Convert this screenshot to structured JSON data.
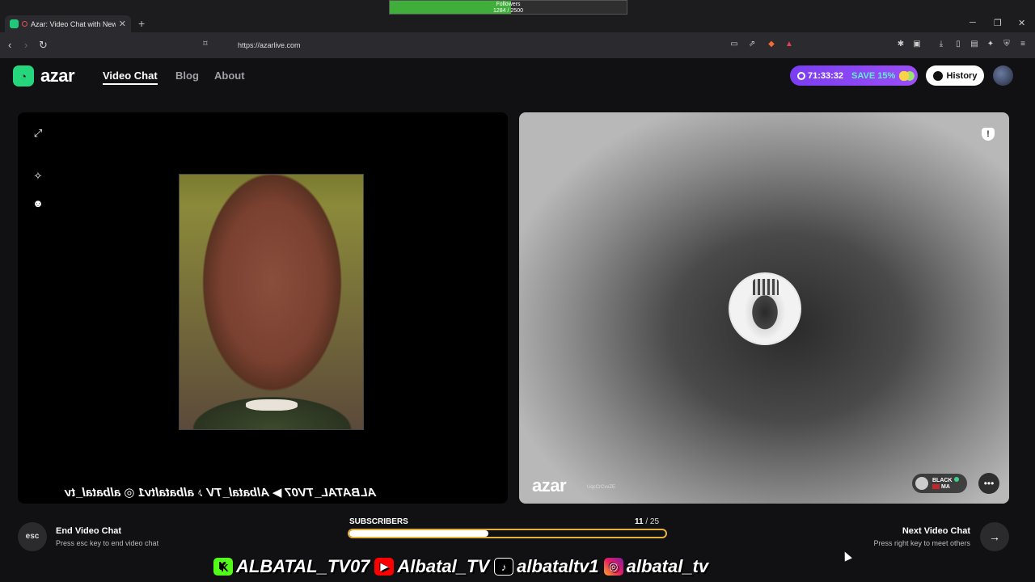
{
  "browser": {
    "tab_title": "Azar: Video Chat with New Pe",
    "url": "https://azarlive.com"
  },
  "followers_overlay": {
    "label": "Followers",
    "current": 1284,
    "goal": 2500,
    "count_text": "1284 / 2500"
  },
  "header": {
    "logo": "azar",
    "nav": [
      "Video Chat",
      "Blog",
      "About"
    ],
    "active_nav": "Video Chat",
    "promo_timer": "71:33:32",
    "promo_save": "SAVE 15%",
    "history_label": "History"
  },
  "left_panel": {
    "mirrored_socials": "ALBATAL_TV07 ▶ Albatal_TV ♪ albataltv1 ◎ albatal_tv"
  },
  "right_panel": {
    "watermark": "azar",
    "watermark_id": "UqcCrCvvZE",
    "partner_name": "BLACK",
    "partner_country": "MA"
  },
  "bottom": {
    "end_key": "esc",
    "end_title": "End Video Chat",
    "end_hint": "Press esc key to end video chat",
    "next_title": "Next Video Chat",
    "next_hint": "Press right key to meet others",
    "subs_label": "SUBSCRIBERS",
    "subs_current": "11",
    "subs_total": "/ 25",
    "subs_fraction": 0.44
  },
  "socials": [
    {
      "icon": "kick-icon",
      "glyph": "K",
      "handle": "ALBATAL_TV07"
    },
    {
      "icon": "youtube-icon",
      "glyph": "▶",
      "handle": "Albatal_TV"
    },
    {
      "icon": "tiktok-icon",
      "glyph": "♪",
      "handle": "albataltv1"
    },
    {
      "icon": "instagram-icon",
      "glyph": "◎",
      "handle": "albatal_tv"
    }
  ]
}
